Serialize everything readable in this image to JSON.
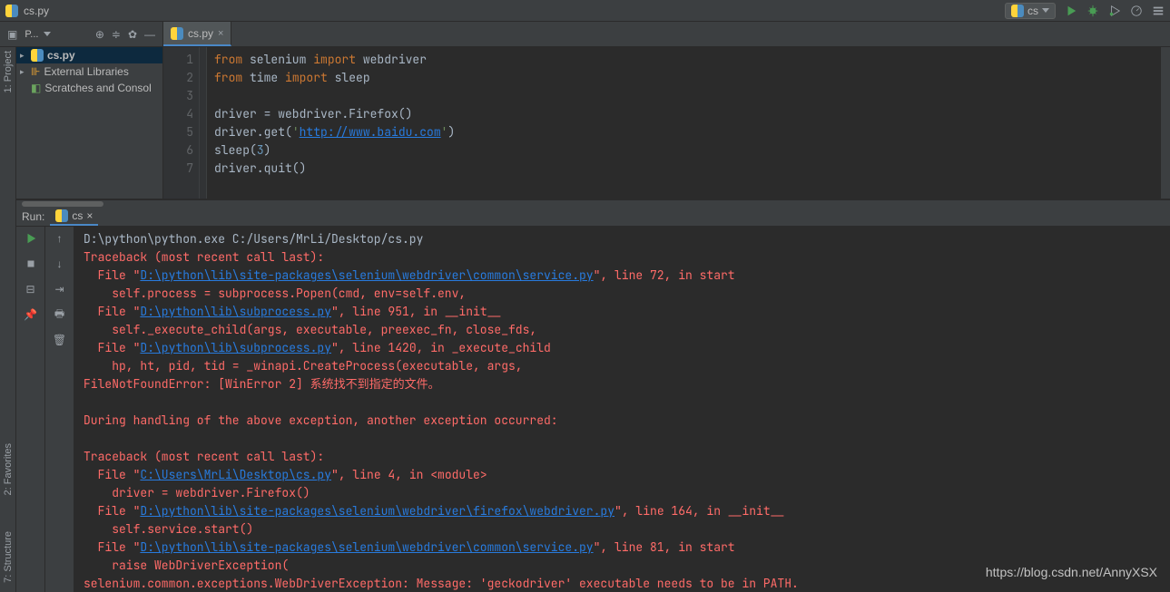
{
  "top": {
    "filename": "cs.py",
    "runConfig": "cs"
  },
  "toolbar": {
    "projectLabel": "P..."
  },
  "tabs": [
    {
      "label": "cs.py"
    }
  ],
  "tree": {
    "items": [
      {
        "label": "cs.py",
        "icon": "py",
        "sel": true
      },
      {
        "label": "External Libraries",
        "icon": "lib"
      },
      {
        "label": "Scratches and Consol",
        "icon": "scratch"
      }
    ]
  },
  "code": {
    "lines": [
      {
        "n": 1,
        "seg": [
          [
            "kw",
            "from"
          ],
          [
            "plain",
            " selenium "
          ],
          [
            "kw",
            "import"
          ],
          [
            "plain",
            " webdriver"
          ]
        ]
      },
      {
        "n": 2,
        "seg": [
          [
            "kw",
            "from"
          ],
          [
            "plain",
            " time "
          ],
          [
            "kw",
            "import"
          ],
          [
            "plain",
            " sleep"
          ]
        ]
      },
      {
        "n": 3,
        "seg": [
          [
            "plain",
            ""
          ]
        ]
      },
      {
        "n": 4,
        "seg": [
          [
            "plain",
            "driver = webdriver.Firefox()"
          ]
        ]
      },
      {
        "n": 5,
        "seg": [
          [
            "plain",
            "driver.get("
          ],
          [
            "str",
            "'"
          ],
          [
            "lnk",
            "http://www.baidu.com"
          ],
          [
            "str",
            "'"
          ],
          [
            "plain",
            ")"
          ]
        ]
      },
      {
        "n": 6,
        "seg": [
          [
            "plain",
            "sleep("
          ],
          [
            "num",
            "3"
          ],
          [
            "plain",
            ")"
          ]
        ]
      },
      {
        "n": 7,
        "seg": [
          [
            "plain",
            "driver.quit()"
          ]
        ]
      }
    ]
  },
  "run": {
    "title": "Run:",
    "tab": "cs",
    "out": [
      [
        [
          "plain",
          "D:\\python\\python.exe C:/Users/MrLi/Desktop/cs.py"
        ]
      ],
      [
        [
          "red",
          "Traceback (most recent call last):"
        ]
      ],
      [
        [
          "red",
          "  File \""
        ],
        [
          "redlink",
          "D:\\python\\lib\\site-packages\\selenium\\webdriver\\common\\service.py"
        ],
        [
          "red",
          "\", line 72, in start"
        ]
      ],
      [
        [
          "red",
          "    self.process = subprocess.Popen(cmd, env=self.env,"
        ]
      ],
      [
        [
          "red",
          "  File \""
        ],
        [
          "redlink",
          "D:\\python\\lib\\subprocess.py"
        ],
        [
          "red",
          "\", line 951, in __init__"
        ]
      ],
      [
        [
          "red",
          "    self._execute_child(args, executable, preexec_fn, close_fds,"
        ]
      ],
      [
        [
          "red",
          "  File \""
        ],
        [
          "redlink",
          "D:\\python\\lib\\subprocess.py"
        ],
        [
          "red",
          "\", line 1420, in _execute_child"
        ]
      ],
      [
        [
          "red",
          "    hp, ht, pid, tid = _winapi.CreateProcess(executable, args,"
        ]
      ],
      [
        [
          "red",
          "FileNotFoundError: [WinError 2] 系统找不到指定的文件。"
        ]
      ],
      [
        [
          "plain",
          ""
        ]
      ],
      [
        [
          "red",
          "During handling of the above exception, another exception occurred:"
        ]
      ],
      [
        [
          "plain",
          ""
        ]
      ],
      [
        [
          "red",
          "Traceback (most recent call last):"
        ]
      ],
      [
        [
          "red",
          "  File \""
        ],
        [
          "redlink",
          "C:\\Users\\MrLi\\Desktop\\cs.py"
        ],
        [
          "red",
          "\", line 4, in <module>"
        ]
      ],
      [
        [
          "red",
          "    driver = webdriver.Firefox()"
        ]
      ],
      [
        [
          "red",
          "  File \""
        ],
        [
          "redlink",
          "D:\\python\\lib\\site-packages\\selenium\\webdriver\\firefox\\webdriver.py"
        ],
        [
          "red",
          "\", line 164, in __init__"
        ]
      ],
      [
        [
          "red",
          "    self.service.start()"
        ]
      ],
      [
        [
          "red",
          "  File \""
        ],
        [
          "redlink",
          "D:\\python\\lib\\site-packages\\selenium\\webdriver\\common\\service.py"
        ],
        [
          "red",
          "\", line 81, in start"
        ]
      ],
      [
        [
          "red",
          "    raise WebDriverException("
        ]
      ],
      [
        [
          "red",
          "selenium.common.exceptions.WebDriverException: Message: 'geckodriver' executable needs to be in PATH."
        ]
      ]
    ]
  },
  "sidetabs": {
    "project": "1: Project",
    "favorites": "2: Favorites",
    "structure": "7: Structure"
  },
  "watermark": "https://blog.csdn.net/AnnyXSX"
}
